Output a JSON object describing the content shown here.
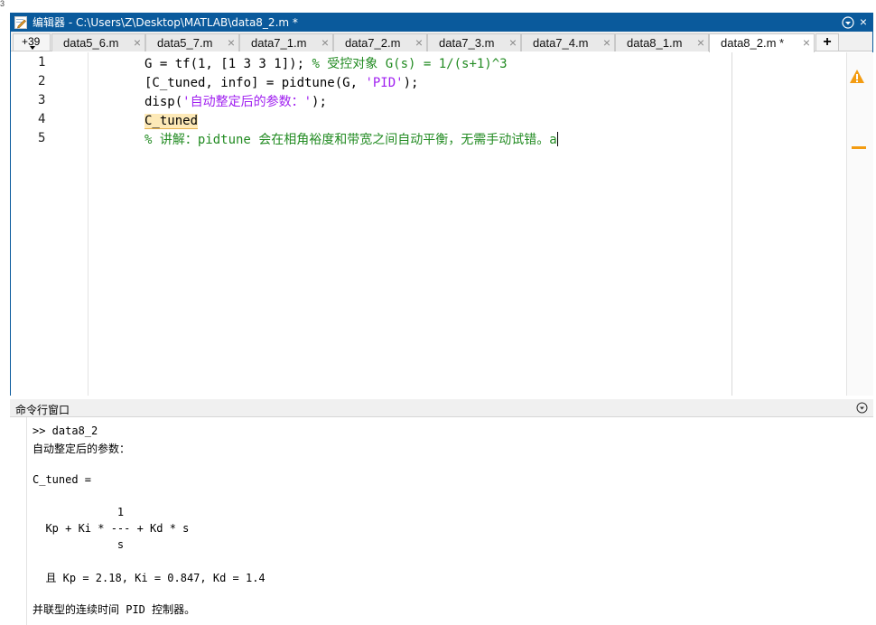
{
  "corner_glyph": "3",
  "window": {
    "title": "编辑器 - C:\\Users\\Z\\Desktop\\MATLAB\\data8_2.m *",
    "close_symbol": "×"
  },
  "tabs": {
    "overflow_label": "+39",
    "items": [
      {
        "label": "data5_6.m"
      },
      {
        "label": "data5_7.m"
      },
      {
        "label": "data7_1.m"
      },
      {
        "label": "data7_2.m"
      },
      {
        "label": "data7_3.m"
      },
      {
        "label": "data7_4.m"
      },
      {
        "label": "data8_1.m"
      },
      {
        "label": "data8_2.m *",
        "active": true
      }
    ],
    "close_symbol": "×",
    "add_symbol": "+"
  },
  "editor": {
    "line_numbers": [
      "1",
      "2",
      "3",
      "4",
      "5"
    ],
    "lines": [
      {
        "code": "G = tf(1, [1 3 3 1]); ",
        "comment": "% 受控对象 G(s) = 1/(s+1)^3"
      },
      {
        "code": "[C_tuned, info] = pidtune(G, ",
        "string": "'PID'",
        "tail": ");"
      },
      {
        "code": "disp(",
        "string": "'自动整定后的参数：'",
        "tail": ");"
      },
      {
        "highlight": "C_tuned"
      },
      {
        "comment": "% 讲解：pidtune 会在相角裕度和带宽之间自动平衡，无需手动试错。a"
      }
    ],
    "warning_color": "#f39c12"
  },
  "command_window": {
    "title": "命令行窗口",
    "lines": [
      ">> data8_2",
      "自动整定后的参数：",
      "",
      "C_tuned =",
      "",
      "",
      "             1",
      "  Kp + Ki * --- + Kd * s",
      "             s",
      "",
      "  且 Kp = 2.18, Ki = 0.847, Kd = 1.4",
      "",
      "并联型的连续时间 PID 控制器。"
    ]
  }
}
